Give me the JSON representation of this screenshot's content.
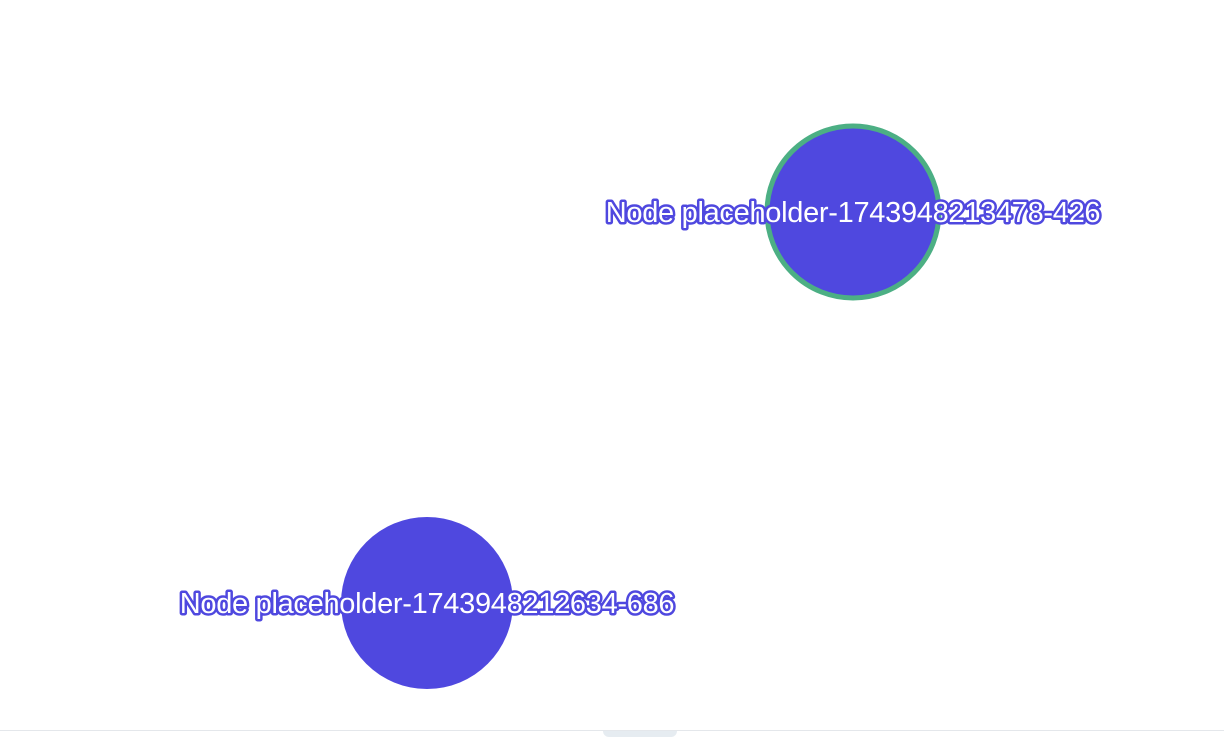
{
  "graph": {
    "nodes": [
      {
        "id": "node-a",
        "label": "Node placeholder-1743948213478-426",
        "selected": true
      },
      {
        "id": "node-b",
        "label": "Node placeholder-1743948212634-686",
        "selected": false
      }
    ],
    "colors": {
      "node_fill": "#4f48df",
      "selected_ring": "#4caf84",
      "label_text": "#ffffff",
      "label_halo": "#4f48df"
    }
  }
}
